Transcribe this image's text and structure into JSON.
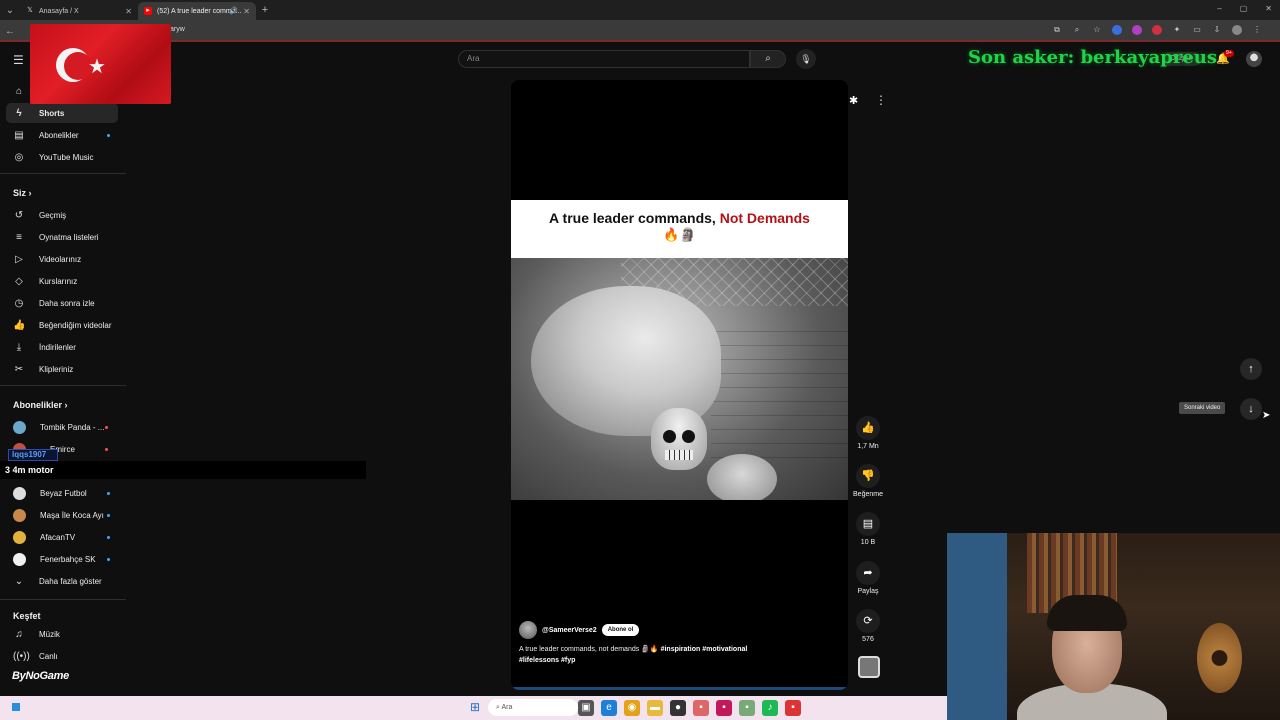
{
  "browser": {
    "tabs": [
      {
        "label": "Anasayfa / X",
        "icon": "x-logo-icon"
      },
      {
        "label": "(52) A true leader comma...",
        "icon": "youtube-icon"
      }
    ],
    "url_fragment": "aryw"
  },
  "youtube": {
    "search_placeholder": "Ara",
    "create_label": "Oluştur",
    "notification_count": "9+",
    "sidebar": {
      "main": [
        {
          "label": "Shorts",
          "icon": "shorts-icon",
          "active": true
        },
        {
          "label": "Abonelikler",
          "icon": "subscriptions-icon"
        },
        {
          "label": "YouTube Music",
          "icon": "music-circle-icon"
        }
      ],
      "you_header": "Siz",
      "you": [
        {
          "label": "Geçmiş",
          "icon": "history-icon"
        },
        {
          "label": "Oynatma listeleri",
          "icon": "playlist-icon"
        },
        {
          "label": "Videolarınız",
          "icon": "video-icon"
        },
        {
          "label": "Kurslarınız",
          "icon": "course-icon"
        },
        {
          "label": "Daha sonra izle",
          "icon": "clock-icon"
        },
        {
          "label": "Beğendiğim videolar",
          "icon": "thumb-up-icon"
        },
        {
          "label": "İndirilenler",
          "icon": "download-icon"
        },
        {
          "label": "Klipleriniz",
          "icon": "scissors-icon"
        }
      ],
      "subs_header": "Abonelikler",
      "subs": [
        {
          "label": "Tombik Panda - ..."
        },
        {
          "label": "Emirce"
        },
        {
          "label": "Beyaz Futbol"
        },
        {
          "label": "Maşa İle Koca Ayı"
        },
        {
          "label": "AfacanTV"
        },
        {
          "label": "Fenerbahçe SK"
        }
      ],
      "show_more": "Daha fazla göster",
      "explore_header": "Keşfet",
      "explore": [
        {
          "label": "Müzik",
          "icon": "music-note-icon"
        },
        {
          "label": "Canlı",
          "icon": "live-icon"
        }
      ]
    },
    "short": {
      "caption_part1": "A true leader commands,",
      "caption_part2": "Not Demands",
      "caption_emoji": "🔥🗿",
      "channel": "@SameerVerse2",
      "subscribe_label": "Abone ol",
      "description": "A true leader commands, not demands 🗿🔥",
      "hashtags": "#inspiration #motivational #lifelessons #fyp"
    },
    "actions": {
      "likes": "1,7 Mn",
      "dislike_label": "Beğenme",
      "comments": "10 B",
      "share_label": "Paylaş",
      "remix_count": "576"
    },
    "next_tooltip": "Sonraki video"
  },
  "stream_overlay": {
    "last_soldier_text": "Son asker: berkayapreus",
    "donation_user": "lqqs1907",
    "donation_text": "3 4m motor",
    "sponsor": "ByNoGame"
  },
  "taskbar": {
    "search_label": "Ara"
  },
  "colors": {
    "youtube_bg": "#0f0f0f",
    "caption_red": "#b31217",
    "overlay_green": "#21d24a"
  }
}
